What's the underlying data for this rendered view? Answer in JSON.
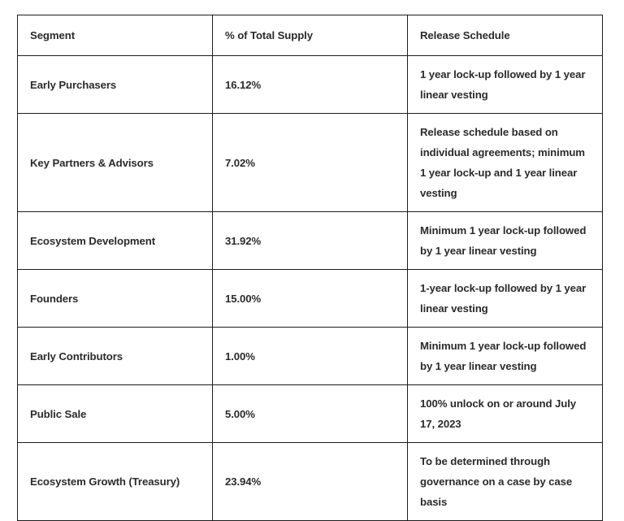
{
  "table": {
    "columns": [
      {
        "key": "segment",
        "label": "Segment"
      },
      {
        "key": "percent",
        "label": "% of Total Supply"
      },
      {
        "key": "schedule",
        "label": "Release Schedule"
      }
    ],
    "rows": [
      {
        "segment": "Early Purchasers",
        "percent": "16.12%",
        "schedule": "1 year lock-up followed by 1 year linear vesting"
      },
      {
        "segment": "Key Partners & Advisors",
        "percent": "7.02%",
        "schedule": "Release schedule based on individual agreements; minimum 1 year lock-up and 1 year linear vesting"
      },
      {
        "segment": "Ecosystem Development",
        "percent": "31.92%",
        "schedule": "Minimum 1 year lock-up followed by 1 year linear vesting"
      },
      {
        "segment": "Founders",
        "percent": "15.00%",
        "schedule": "1-year lock-up followed by 1 year linear vesting"
      },
      {
        "segment": "Early Contributors",
        "percent": "1.00%",
        "schedule": "Minimum 1 year lock-up followed by 1 year linear vesting"
      },
      {
        "segment": "Public Sale",
        "percent": "5.00%",
        "schedule": "100% unlock on or around July 17, 2023"
      },
      {
        "segment": "Ecosystem Growth (Treasury)",
        "percent": "23.94%",
        "schedule": "To be determined through governance on a case by case basis"
      }
    ]
  },
  "colors": {
    "border": "#1c1c1c",
    "text": "#2b2b2b",
    "background": "#ffffff"
  }
}
